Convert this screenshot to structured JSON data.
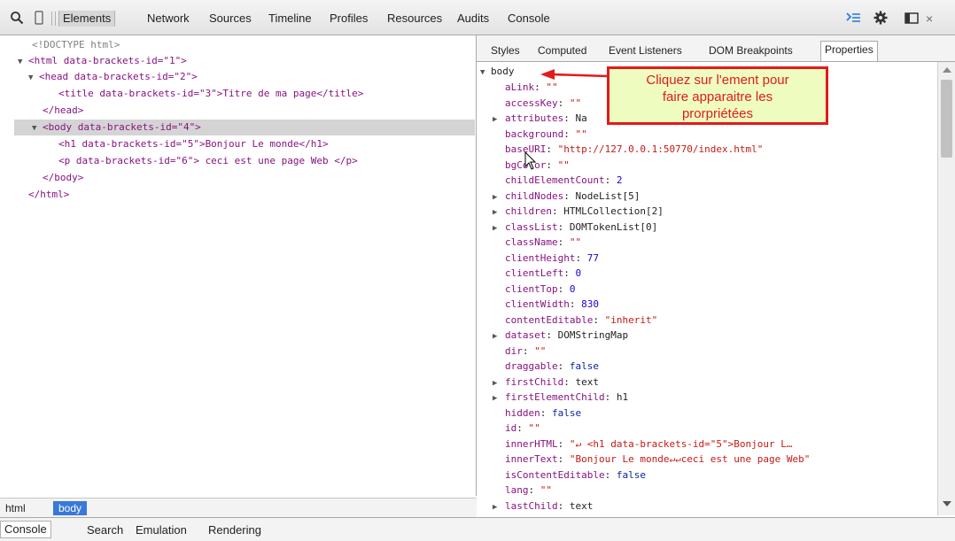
{
  "toolbar": {
    "tabs": [
      "Elements",
      "Network",
      "Sources",
      "Timeline",
      "Profiles",
      "Resources",
      "Audits",
      "Console"
    ],
    "close": "×"
  },
  "dom": {
    "lines": [
      "<!DOCTYPE html>",
      "<html data-brackets-id=\"1\">",
      "<head data-brackets-id=\"2\">",
      "<title data-brackets-id=\"3\">Titre de ma page</title>",
      "</head>",
      "<body data-brackets-id=\"4\">",
      "<h1 data-brackets-id=\"5\">Bonjour Le monde</h1>",
      "<p data-brackets-id=\"6\"> ceci est une page Web </p>",
      "</body>",
      "</html>"
    ]
  },
  "breadcrumb": [
    "html",
    "body"
  ],
  "side_tabs": [
    "Styles",
    "Computed",
    "Event Listeners",
    "DOM Breakpoints",
    "Properties"
  ],
  "props": {
    "root": "body",
    "items": [
      {
        "k": "aLink",
        "v": "\"\"",
        "t": "s",
        "exp": false
      },
      {
        "k": "accessKey",
        "v": "\"\"",
        "t": "s",
        "exp": false
      },
      {
        "k": "attributes",
        "v": "Na",
        "t": "o",
        "exp": true
      },
      {
        "k": "background",
        "v": "\"\"",
        "t": "s",
        "exp": false
      },
      {
        "k": "baseURI",
        "v": "\"http://127.0.0.1:50770/index.html\"",
        "t": "s",
        "exp": false
      },
      {
        "k": "bgColor",
        "v": "\"\"",
        "t": "s",
        "exp": false
      },
      {
        "k": "childElementCount",
        "v": "2",
        "t": "n",
        "exp": false
      },
      {
        "k": "childNodes",
        "v": "NodeList[5]",
        "t": "o",
        "exp": true
      },
      {
        "k": "children",
        "v": "HTMLCollection[2]",
        "t": "o",
        "exp": true
      },
      {
        "k": "classList",
        "v": "DOMTokenList[0]",
        "t": "o",
        "exp": true
      },
      {
        "k": "className",
        "v": "\"\"",
        "t": "s",
        "exp": false
      },
      {
        "k": "clientHeight",
        "v": "77",
        "t": "n",
        "exp": false
      },
      {
        "k": "clientLeft",
        "v": "0",
        "t": "n",
        "exp": false
      },
      {
        "k": "clientTop",
        "v": "0",
        "t": "n",
        "exp": false
      },
      {
        "k": "clientWidth",
        "v": "830",
        "t": "n",
        "exp": false
      },
      {
        "k": "contentEditable",
        "v": "\"inherit\"",
        "t": "s",
        "exp": false
      },
      {
        "k": "dataset",
        "v": "DOMStringMap",
        "t": "o",
        "exp": true
      },
      {
        "k": "dir",
        "v": "\"\"",
        "t": "s",
        "exp": false
      },
      {
        "k": "draggable",
        "v": "false",
        "t": "b",
        "exp": false
      },
      {
        "k": "firstChild",
        "v": "text",
        "t": "o",
        "exp": true
      },
      {
        "k": "firstElementChild",
        "v": "h1",
        "t": "o",
        "exp": true
      },
      {
        "k": "hidden",
        "v": "false",
        "t": "b",
        "exp": false
      },
      {
        "k": "id",
        "v": "\"\"",
        "t": "s",
        "exp": false
      },
      {
        "k": "innerHTML",
        "v": "\"↵        <h1 data-brackets-id=\"5\">Bonjour L…",
        "t": "s",
        "exp": false
      },
      {
        "k": "innerText",
        "v": "\"Bonjour Le monde↵↵ceci est une page Web\"",
        "t": "s",
        "exp": false
      },
      {
        "k": "isContentEditable",
        "v": "false",
        "t": "b",
        "exp": false
      },
      {
        "k": "lang",
        "v": "\"\"",
        "t": "s",
        "exp": false
      },
      {
        "k": "lastChild",
        "v": "text",
        "t": "o",
        "exp": true
      }
    ]
  },
  "callout": {
    "line1": "Cliquez sur l'ement pour",
    "line2": "faire apparaitre les",
    "line3": "prorpriétées"
  },
  "drawer": [
    "Console",
    "Search",
    "Emulation",
    "Rendering"
  ],
  "colors": {
    "accent_blue": "#3879d9",
    "annotation_red": "#e21b1b",
    "annotation_bg": "#eefcc0"
  },
  "icons": [
    "search-icon",
    "device-mode-icon",
    "console-toggle-icon",
    "gear-icon",
    "dock-icon",
    "close-icon"
  ]
}
